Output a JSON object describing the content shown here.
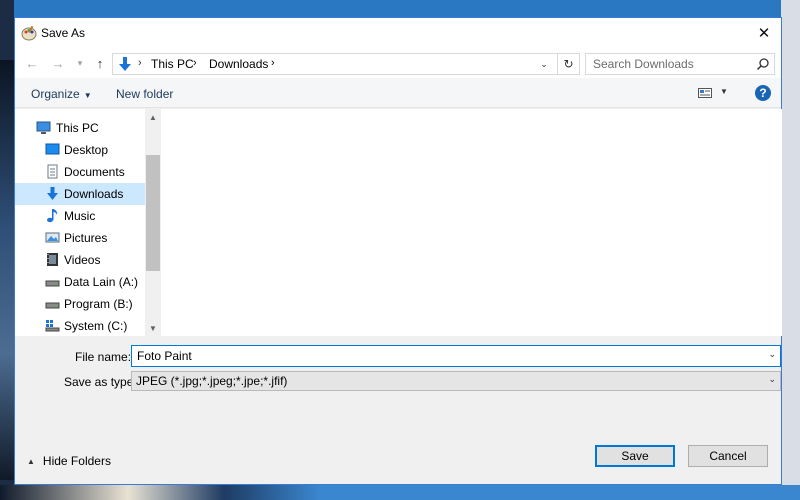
{
  "dialog": {
    "title": "Save As",
    "close_glyph": "✕"
  },
  "nav": {
    "back_glyph": "←",
    "forward_glyph": "→",
    "recent_glyph": "▾",
    "up_glyph": "↑",
    "breadcrumb": [
      "This PC",
      "Downloads"
    ],
    "separator": "›",
    "address_dropdown_glyph": "⌄",
    "refresh_glyph": "↻"
  },
  "search": {
    "placeholder": "Search Downloads"
  },
  "toolbar": {
    "organize_label": "Organize",
    "organize_arrow": "▼",
    "new_folder_label": "New folder",
    "view_dropdown_glyph": "▼",
    "help_glyph": "?"
  },
  "sidebar": {
    "items": [
      {
        "label": "This PC",
        "icon": "computer-icon"
      },
      {
        "label": "Desktop",
        "icon": "desktop-icon"
      },
      {
        "label": "Documents",
        "icon": "documents-icon"
      },
      {
        "label": "Downloads",
        "icon": "downloads-icon",
        "selected": true
      },
      {
        "label": "Music",
        "icon": "music-icon"
      },
      {
        "label": "Pictures",
        "icon": "pictures-icon"
      },
      {
        "label": "Videos",
        "icon": "videos-icon"
      },
      {
        "label": "Data Lain (A:)",
        "icon": "drive-icon"
      },
      {
        "label": "Program (B:)",
        "icon": "drive-icon"
      },
      {
        "label": "System (C:)",
        "icon": "system-drive-icon"
      }
    ],
    "scroll_up_glyph": "▲",
    "scroll_down_glyph": "▼"
  },
  "form": {
    "filename_label": "File name:",
    "filename_value": "Foto Paint",
    "filename_dropdown_glyph": "⌄",
    "type_label": "Save as type:",
    "type_value": "JPEG (*.jpg;*.jpeg;*.jpe;*.jfif)",
    "type_dropdown_glyph": "⌄"
  },
  "footer": {
    "hide_folders_arrow": "▲",
    "hide_folders_label": "Hide Folders",
    "save_label": "Save",
    "cancel_label": "Cancel"
  },
  "colors": {
    "accent": "#0078d7",
    "selected_bg": "#cce8ff",
    "link_text": "#1e395b"
  }
}
